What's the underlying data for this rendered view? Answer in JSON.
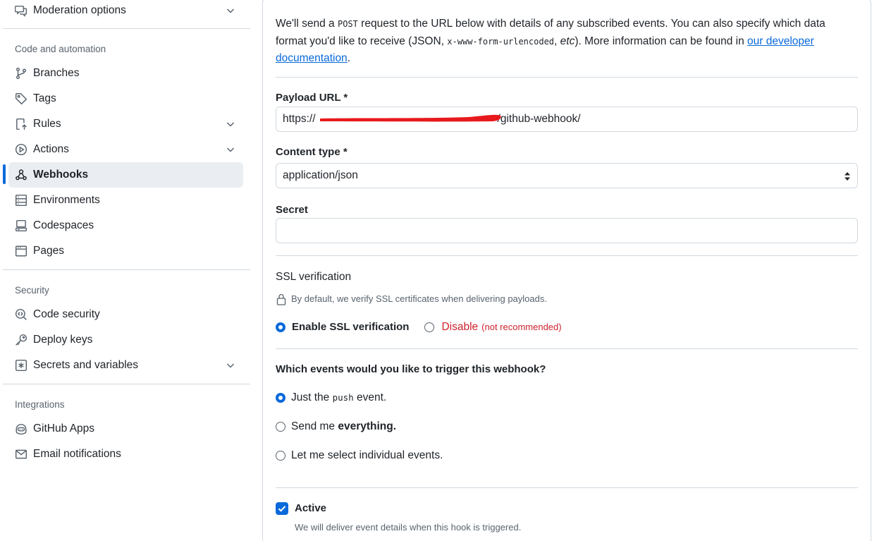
{
  "sidebar": {
    "top_item": {
      "label": "Moderation options",
      "icon": "comment-discussion-icon",
      "expandable": true
    },
    "sections": [
      {
        "heading": "Code and automation",
        "items": [
          {
            "label": "Branches",
            "icon": "git-branch-icon",
            "expandable": false
          },
          {
            "label": "Tags",
            "icon": "tag-icon",
            "expandable": false
          },
          {
            "label": "Rules",
            "icon": "repo-push-icon",
            "expandable": true
          },
          {
            "label": "Actions",
            "icon": "play-icon",
            "expandable": true
          },
          {
            "label": "Webhooks",
            "icon": "webhook-icon",
            "expandable": false,
            "active": true
          },
          {
            "label": "Environments",
            "icon": "server-icon",
            "expandable": false
          },
          {
            "label": "Codespaces",
            "icon": "codespaces-icon",
            "expandable": false
          },
          {
            "label": "Pages",
            "icon": "browser-icon",
            "expandable": false
          }
        ]
      },
      {
        "heading": "Security",
        "items": [
          {
            "label": "Code security",
            "icon": "codescan-icon",
            "expandable": false
          },
          {
            "label": "Deploy keys",
            "icon": "key-icon",
            "expandable": false
          },
          {
            "label": "Secrets and variables",
            "icon": "asterisk-icon",
            "expandable": true
          }
        ]
      },
      {
        "heading": "Integrations",
        "items": [
          {
            "label": "GitHub Apps",
            "icon": "copilot-icon",
            "expandable": false
          },
          {
            "label": "Email notifications",
            "icon": "mail-icon",
            "expandable": false
          }
        ]
      }
    ]
  },
  "main": {
    "intro": {
      "part1": "We'll send a ",
      "code1": "POST",
      "part2": " request to the URL below with details of any subscribed events. You can also specify which data format you'd like to receive (JSON, ",
      "code2": "x-www-form-urlencoded",
      "part3": ", ",
      "etc": "etc",
      "part4": "). More information can be found in ",
      "link": "our developer documentation",
      "part5": "."
    },
    "payload_url": {
      "label": "Payload URL *",
      "value_start": "https://",
      "value_end": "/github-webhook/"
    },
    "content_type": {
      "label": "Content type *",
      "value": "application/json"
    },
    "secret": {
      "label": "Secret",
      "value": ""
    },
    "ssl": {
      "label": "SSL verification",
      "hint": "By default, we verify SSL certificates when delivering payloads.",
      "enable_label": "Enable SSL verification",
      "disable_label": "Disable",
      "disable_note": "(not recommended)",
      "selected": "enable"
    },
    "events": {
      "label": "Which events would you like to trigger this webhook?",
      "options": [
        {
          "pre": "Just the ",
          "code": "push",
          "post": " event.",
          "checked": true
        },
        {
          "pre": "Send me ",
          "bold": "everything.",
          "checked": false
        },
        {
          "pre": "Let me select individual events.",
          "checked": false
        }
      ]
    },
    "active": {
      "label": "Active",
      "hint": "We will deliver event details when this hook is triggered.",
      "checked": true
    }
  },
  "colors": {
    "accent": "#0969da",
    "danger": "#cf222e",
    "muted": "#59636e",
    "border": "#d1d9e0",
    "active_bg": "#eaeef2",
    "redaction": "#e8191c"
  }
}
